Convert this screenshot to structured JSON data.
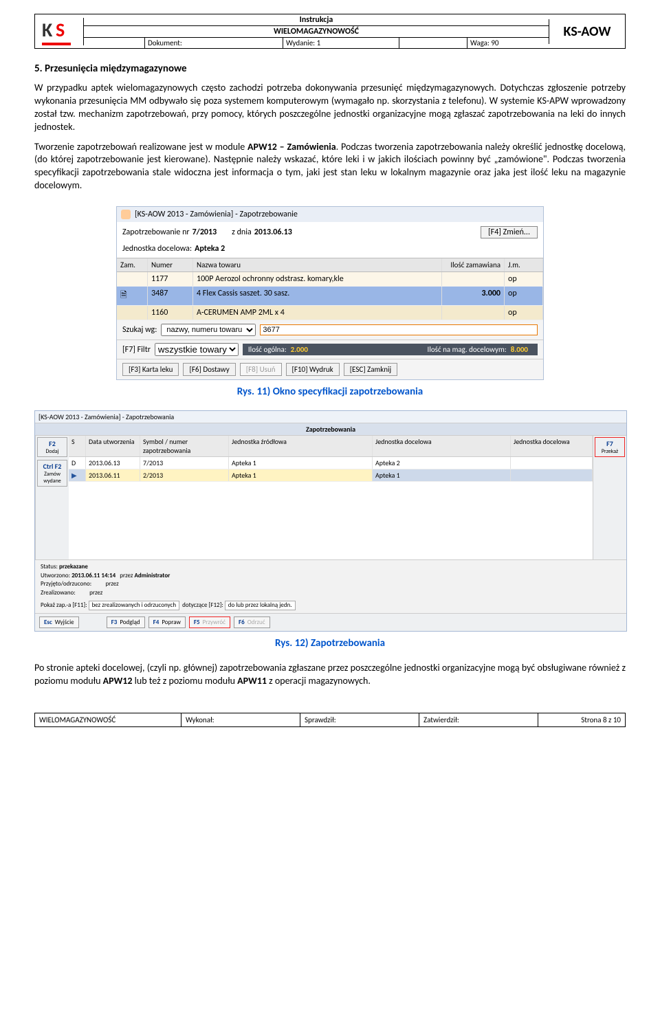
{
  "header": {
    "title1": "Instrukcja",
    "title2": "WIELOMAGAZYNOWOŚĆ",
    "dokument_lbl": "Dokument:",
    "wydanie_lbl": "Wydanie: 1",
    "waga_lbl": "Waga: 90",
    "brand": "KS-AOW"
  },
  "section_title": "5. Przesunięcia międzymagazynowe",
  "para1": "W przypadku aptek wielomagazynowych często zachodzi potrzeba dokonywania przesunięć międzymagazynowych. Dotychczas zgłoszenie potrzeby wykonania przesunięcia MM odbywało się poza systemem komputerowym (wymagało np. skorzystania z telefonu). W systemie KS-APW wprowadzony został tzw. mechanizm zapotrzebowań, przy pomocy, których poszczególne jednostki organizacyjne mogą zgłaszać zapotrzebowania na leki do innych jednostek.",
  "para2_a": "Tworzenie zapotrzebowań realizowane jest w module ",
  "para2_b": "APW12 – Zamówienia",
  "para2_c": ". Podczas tworzenia zapotrzebowania należy określić jednostkę docelową, (do której zapotrzebowanie jest kierowane). Następnie należy wskazać, które leki i w jakich ilościach powinny być „zamówione\". Podczas tworzenia specyfikacji zapotrzebowania stale widoczna jest informacja o tym, jaki jest stan leku w lokalnym magazynie oraz jaka jest ilość leku na magazynie docelowym.",
  "fig1": {
    "titlebar": "[KS-AOW 2013 - Zamówienia] - Zapotrzebowanie",
    "zap_lbl": "Zapotrzebowanie nr",
    "zap_val": "7/2013",
    "date_lbl": "z dnia",
    "date_val": "2013.06.13",
    "btn_change": "[F4] Zmień...",
    "jed_lbl": "Jednostka docelowa:",
    "jed_val": "Apteka 2",
    "cols": {
      "zam": "Zam.",
      "numer": "Numer",
      "nazwa": "Nazwa towaru",
      "ilosc": "Ilość zamawiana",
      "jm": "J.m."
    },
    "rows": [
      {
        "zam": "",
        "numer": "1177",
        "nazwa": "100P Aerozol ochronny odstrasz. komary,kle",
        "ilosc": "",
        "jm": "op"
      },
      {
        "zam": "🗎",
        "numer": "3487",
        "nazwa": "4 Flex Cassis saszet. 30 sasz.",
        "ilosc": "3.000",
        "jm": "op"
      },
      {
        "zam": "",
        "numer": "1160",
        "nazwa": "A-CERUMEN AMP 2ML x 4",
        "ilosc": "",
        "jm": "op"
      }
    ],
    "search_lbl": "Szukaj wg:",
    "search_sel": "nazwy, numeru towaru",
    "search_val": "3677",
    "filter_lbl": "[F7] Filtr",
    "filter_sel": "wszystkie towary",
    "stat_l": "Ilość ogólna:",
    "stat_lv": "2.000",
    "stat_r": "Ilość na mag. docelowym:",
    "stat_rv": "8.000",
    "btns": {
      "karta": "[F3] Karta leku",
      "dost": "[F6] Dostawy",
      "usun": "[F8] Usuń",
      "wydr": "[F10] Wydruk",
      "zam": "[ESC] Zamknij"
    }
  },
  "caption1": "Rys. 11) Okno specyfikacji zapotrzebowania",
  "fig2": {
    "titlebar": "[KS-AOW 2013 - Zamówienia] - Zapotrzebowania",
    "header": "Zapotrzebowania",
    "cols": {
      "s": "S",
      "data": "Data utworzenia",
      "sym": "Symbol / numer zapotrzebowania",
      "jz": "Jednostka źródłowa",
      "jd": "Jednostka docelowa"
    },
    "rows": [
      {
        "s": "D",
        "data": "2013.06.13",
        "sym": "7/2013",
        "jz": "Apteka 1",
        "jd": "Apteka 2"
      },
      {
        "s": "▶",
        "data": "2013.06.11",
        "sym": "2/2013",
        "jz": "Apteka 1",
        "jd": "Apteka 1"
      }
    ],
    "side_left": [
      {
        "k": "F2",
        "t": "Dodaj"
      },
      {
        "k": "Ctrl F2",
        "t": "Zamów wydane"
      }
    ],
    "side_right": [
      {
        "k": "F7",
        "t": "Przekaż"
      }
    ],
    "status": {
      "s1": "Status:",
      "s1v": "przekazane",
      "s2": "Utworzono:",
      "s2v": "2013.06.11    14:14",
      "s2b": "przez",
      "s2c": "Administrator",
      "s3": "Przyjęto/odrzucono:",
      "s3b": "przez",
      "s4": "Zrealizowano:",
      "s4b": "przez",
      "p1": "Pokaż zap.-a [F11]:",
      "p1v": "bez zrealizowanych i odrzuconych",
      "p2": "dotyczące [F12]:",
      "p2v": "do lub przez lokalną jedn."
    },
    "bottom": [
      {
        "k": "Esc",
        "t": "Wyjście",
        "cls": ""
      },
      {
        "k": "F3",
        "t": "Podgląd",
        "cls": ""
      },
      {
        "k": "F4",
        "t": "Popraw",
        "cls": ""
      },
      {
        "k": "F5",
        "t": "Przywróć",
        "cls": "red dis"
      },
      {
        "k": "F6",
        "t": "Odrzuć",
        "cls": "dis"
      }
    ]
  },
  "caption2": "Rys. 12) Zapotrzebowania",
  "para3_a": "Po stronie apteki docelowej, (czyli np. głównej) zapotrzebowania zgłaszane przez poszczególne jednostki organizacyjne mogą być obsługiwane również z poziomu modułu ",
  "para3_b": "APW12",
  "para3_c": " lub też z poziomu modułu ",
  "para3_d": "APW11",
  "para3_e": " z operacji magazynowych.",
  "footer": {
    "col1": "WIELOMAGAZYNOWOŚĆ",
    "col2": "Wykonał:",
    "col3": "Sprawdził:",
    "col4": "Zatwierdził:",
    "col5": "Strona 8 z 10"
  }
}
